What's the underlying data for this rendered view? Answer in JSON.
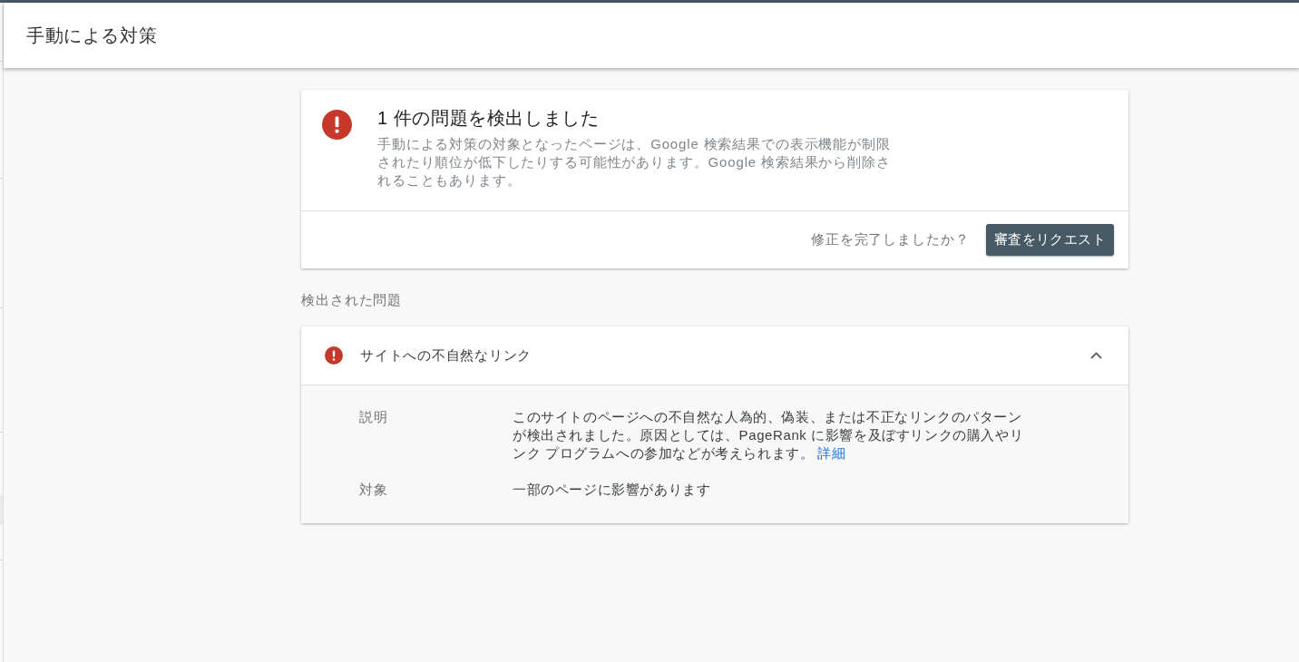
{
  "header": {
    "title": "手動による対策"
  },
  "summary": {
    "title": "1 件の問題を検出しました",
    "description": "手動による対策の対象となったページは、Google 検索結果での表示機能が制限されたり順位が低下したりする可能性があります。Google 検索結果から削除されることもあります。",
    "prompt": "修正を完了しましたか？",
    "button": "審査をリクエスト"
  },
  "issues_heading": "検出された問題",
  "issues": [
    {
      "title": "サイトへの不自然なリンク",
      "expanded": true,
      "details": [
        {
          "label": "説明",
          "text": "このサイトのページへの不自然な人為的、偽装、または不正なリンクのパターンが検出されました。原因としては、PageRank に影響を及ぼすリンクの購入やリンク プログラムへの参加などが考えられます。",
          "link": "詳細"
        },
        {
          "label": "対象",
          "text": "一部のページに影響があります"
        }
      ]
    }
  ]
}
